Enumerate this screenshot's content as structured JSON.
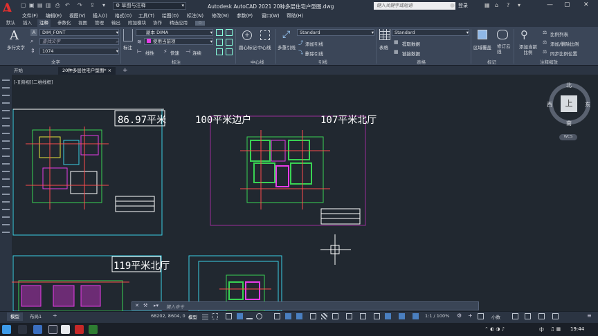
{
  "app": {
    "logo_letter": "A",
    "title": "Autodesk AutoCAD 2021    20种多层住宅户型图.dwg",
    "workspace": "草图与注释",
    "search_placeholder": "键入关键字或短语",
    "login_label": "登录"
  },
  "menu": [
    "文件(F)",
    "编辑(E)",
    "视图(V)",
    "插入(I)",
    "格式(O)",
    "工具(T)",
    "绘图(D)",
    "标注(N)",
    "修改(M)",
    "参数(P)",
    "窗口(W)",
    "帮助(H)"
  ],
  "ribbon_tabs": [
    "默认",
    "插入",
    "注释",
    "参数化",
    "视图",
    "管理",
    "输出",
    "附加模块",
    "协作",
    "精选应用"
  ],
  "ribbon_active_tab": "注释",
  "ribbon": {
    "text_group": {
      "multiline_text": "多行文字",
      "font_combo": "DIM_FONT",
      "find_placeholder": "查找文字",
      "height_combo": "1074",
      "group_label": "文字"
    },
    "dim_group": {
      "dim_label": "标注",
      "dim_style": "副本 DIMA",
      "layer_combo": "使用当前项",
      "linear": "线性",
      "quick": "快速",
      "continue": "连续",
      "group_label": "标注"
    },
    "centerline_group": {
      "center_mark": "圆心标记",
      "centerline": "中心线",
      "group_label": "中心线"
    },
    "leader_group": {
      "multileader": "多重引线",
      "style": "Standard",
      "add_leader": "添加引线",
      "remove_leader": "删除引线",
      "group_label": "引线"
    },
    "table_group": {
      "table": "表格",
      "style": "Standard",
      "extract": "提取数据",
      "link": "链接数据",
      "group_label": "表格"
    },
    "markup_group": {
      "wipeout": "区域覆盖",
      "revcloud": "修订云线",
      "group_label": "标记"
    },
    "scale_group": {
      "add_current": "添加当前比例",
      "scale_list": "比例列表",
      "add_delete": "添加/删除比例",
      "sync": "同步比例位置",
      "group_label": "注释缩放"
    }
  },
  "file_tabs": [
    "开始",
    "20种多层住宅户型图*"
  ],
  "active_file_tab": "20种多层住宅户型图*",
  "view_label": "[-][俯视][二维线框]",
  "drawing_labels": [
    "86.97平米",
    "100平米边户",
    "107平米北厅",
    "119平米北厅"
  ],
  "viewcube": {
    "north": "北",
    "south": "南",
    "east": "东",
    "west": "西",
    "top": "上",
    "wcs": "WCS"
  },
  "command_prompt": "键入命令",
  "status": {
    "layout_tabs": [
      "模型",
      "布局1"
    ],
    "coords": "68202, 8604, 0",
    "model_label": "模型",
    "scale": "1:1 / 100%",
    "units": "小数"
  },
  "taskbar": {
    "clock": "19:44",
    "ime": "中"
  },
  "colors": {
    "plan_green": "#39d353",
    "plan_magenta": "#e83ce8",
    "plan_yellow": "#e6e63a",
    "plan_cyan": "#3ad1e6",
    "frame_border": "#9a2e9a"
  }
}
